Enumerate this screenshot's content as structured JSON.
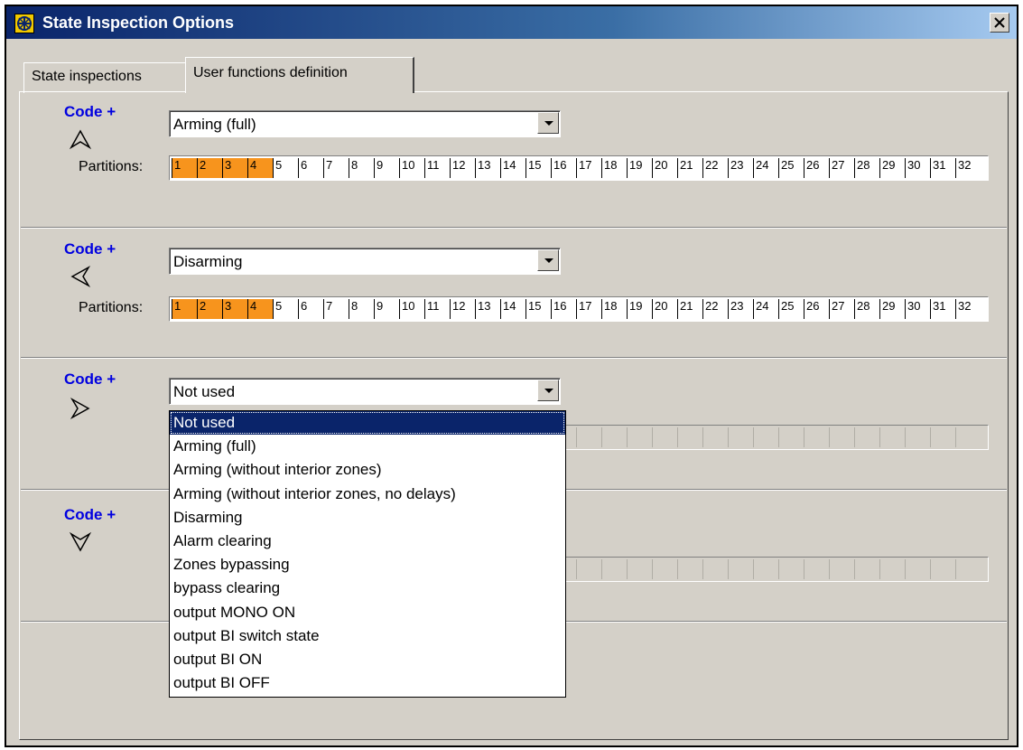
{
  "window": {
    "title": "State Inspection Options",
    "close_glyph": "×",
    "icon": "app-logo-icon"
  },
  "tabs": [
    {
      "label": "State inspections",
      "active": false
    },
    {
      "label": "User functions definition",
      "active": true
    }
  ],
  "sections": [
    {
      "code_label": "Code +",
      "arrow": "arrow-up-icon",
      "selected": "Arming (full)",
      "partitions_label": "Partitions:",
      "partitions_enabled": true,
      "active_partitions": [
        1,
        2,
        3,
        4
      ]
    },
    {
      "code_label": "Code +",
      "arrow": "arrow-left-icon",
      "selected": "Disarming",
      "partitions_label": "Partitions:",
      "partitions_enabled": true,
      "active_partitions": [
        1,
        2,
        3,
        4
      ]
    },
    {
      "code_label": "Code +",
      "arrow": "arrow-right-icon",
      "selected": "Not used",
      "partitions_enabled": false
    },
    {
      "code_label": "Code +",
      "arrow": "arrow-down-icon",
      "partitions_enabled": false
    }
  ],
  "partitions": [
    "1",
    "2",
    "3",
    "4",
    "5",
    "6",
    "7",
    "8",
    "9",
    "10",
    "11",
    "12",
    "13",
    "14",
    "15",
    "16",
    "17",
    "18",
    "19",
    "20",
    "21",
    "22",
    "23",
    "24",
    "25",
    "26",
    "27",
    "28",
    "29",
    "30",
    "31",
    "32"
  ],
  "dropdown_options": [
    "Not used",
    "Arming (full)",
    "Arming (without interior zones)",
    "Arming (without interior zones, no delays)",
    "Disarming",
    "Alarm clearing",
    "Zones bypassing",
    "bypass clearing",
    "output MONO ON",
    "output BI switch state",
    "output BI ON",
    "output BI OFF"
  ],
  "dropdown_highlighted": "Not used",
  "colors": {
    "partition_on": "#f7941d",
    "code_label": "#0000e0",
    "titlebar": "#0a246a"
  }
}
